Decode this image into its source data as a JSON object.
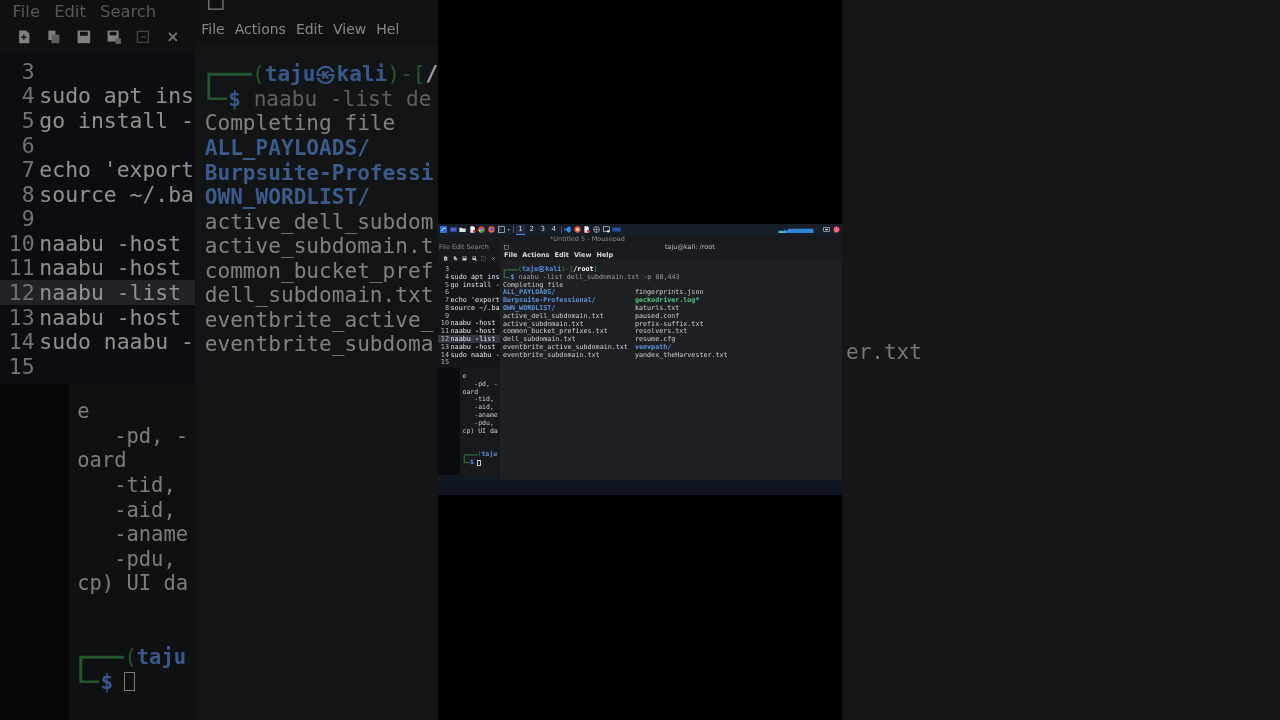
{
  "left_backdrop": {
    "editor": {
      "menu": [
        "File",
        "Edit",
        "Search"
      ],
      "lines": [
        {
          "number": "3",
          "selected": false
        },
        {
          "number": "4",
          "code": "sudo apt ins",
          "selected": false
        },
        {
          "number": "5",
          "code": "go install -",
          "selected": false
        },
        {
          "number": "6",
          "selected": false
        },
        {
          "number": "7",
          "code": "echo 'export",
          "selected": false
        },
        {
          "number": "8",
          "code": "source ~/.ba",
          "selected": false
        },
        {
          "number": "9",
          "selected": false
        },
        {
          "number": "10",
          "code": "naabu -host",
          "selected": false
        },
        {
          "number": "11",
          "code": "naabu -host",
          "selected": false
        },
        {
          "number": "12",
          "code": "naabu -list",
          "selected": true
        },
        {
          "number": "13",
          "code": "naabu -host",
          "selected": false
        },
        {
          "number": "14",
          "code": "sudo naabu -",
          "selected": false
        },
        {
          "number": "15",
          "selected": false
        }
      ]
    },
    "terminal": {
      "menu": [
        "File",
        "Actions",
        "Edit",
        "View",
        "Hel"
      ],
      "prompt": "(**taju㉿kali**)-[**/**",
      "symbol": "$",
      "command": "naabu -list de",
      "message": "Completing file",
      "listing": [
        {
          "name": "ALL_PAYLOADS/",
          "kind": "dir"
        },
        {
          "name": "Burpsuite-Professi",
          "kind": "dir"
        },
        {
          "name": "OWN_WORDLIST/",
          "kind": "dir"
        },
        {
          "name": "active_dell_subdom",
          "kind": "file"
        },
        {
          "name": "active_subdomain.t",
          "kind": "file"
        },
        {
          "name": "common_bucket_pref",
          "kind": "file"
        },
        {
          "name": "dell_subdomain.txt",
          "kind": "file"
        },
        {
          "name": "eventbrite_active_",
          "kind": "file"
        },
        {
          "name": "eventbrite_subdoma",
          "kind": "file"
        }
      ]
    },
    "back_terminal": {
      "lines": [
        "e",
        "   -pd, -",
        "oard",
        "   -tid,",
        "   -aid,",
        "   -aname",
        "   -pdu,",
        "cp) UI da"
      ],
      "prompt": "(**taju**",
      "symbol": "$"
    }
  },
  "center_screen": {
    "taskbar": {
      "workspaces": [
        {
          "label": "1",
          "selected": true
        },
        {
          "label": "2",
          "selected": false
        },
        {
          "label": "3",
          "selected": false
        },
        {
          "label": "4",
          "selected": false
        }
      ]
    },
    "editor": {
      "title": "*Untitled 5 - Mousepad",
      "menu": [
        "File",
        "Edit",
        "Search"
      ],
      "lines": [
        {
          "number": "3",
          "selected": false
        },
        {
          "number": "4",
          "code": "sudo apt ins",
          "selected": false
        },
        {
          "number": "5",
          "code": "go install -",
          "selected": false
        },
        {
          "number": "6",
          "selected": false
        },
        {
          "number": "7",
          "code": "echo 'export",
          "selected": false
        },
        {
          "number": "8",
          "code": "source ~/.ba",
          "selected": false
        },
        {
          "number": "9",
          "selected": false
        },
        {
          "number": "10",
          "code": "naabu -host",
          "selected": false
        },
        {
          "number": "11",
          "code": "naabu -host",
          "selected": false
        },
        {
          "number": "12",
          "code": "naabu -list",
          "selected": true
        },
        {
          "number": "13",
          "code": "naabu -host",
          "selected": false
        },
        {
          "number": "14",
          "code": "sudo naabu -",
          "selected": false
        },
        {
          "number": "15",
          "selected": false
        }
      ]
    },
    "terminal": {
      "title": "taju@kali: /root",
      "menu": [
        "File",
        "Actions",
        "Edit",
        "View",
        "Help"
      ],
      "prompt": "(**taju㉿kali**)-[**/root**]",
      "symbol": "$",
      "command": "naabu -list dell_subdomain.txt -p 80,443",
      "message": "Completing file",
      "listing": [
        {
          "name": "ALL_PAYLOADS/",
          "kind": "dir"
        },
        {
          "name": "Burpsuite-Professional/",
          "kind": "dir"
        },
        {
          "name": "OWN_WORDLIST/",
          "kind": "dir"
        },
        {
          "name": "active_dell_subdomain.txt",
          "kind": "file"
        },
        {
          "name": "active_subdomain.txt",
          "kind": "file"
        },
        {
          "name": "common_bucket_prefixes.txt",
          "kind": "file"
        },
        {
          "name": "dell_subdomain.txt",
          "kind": "file"
        },
        {
          "name": "eventbrite_active_subdomain.txt",
          "kind": "file"
        },
        {
          "name": "eventbrite_subdomain.txt",
          "kind": "file"
        },
        {
          "name": "fingerprints.json",
          "kind": "file"
        },
        {
          "name": "geckodriver.log*",
          "kind": "exec"
        },
        {
          "name": "katurls.txt",
          "kind": "file"
        },
        {
          "name": "paused.conf",
          "kind": "file"
        },
        {
          "name": "prefix-suffix.txt",
          "kind": "file"
        },
        {
          "name": "resolvers.txt",
          "kind": "file"
        },
        {
          "name": "resume.cfg",
          "kind": "file"
        },
        {
          "name": "venvpath/",
          "kind": "dir"
        },
        {
          "name": "yandex_theHarvester.txt",
          "kind": "file"
        }
      ]
    },
    "back_terminal": {
      "lines": [
        "e",
        "   -pd, -",
        "oard",
        "   -tid,",
        "   -aid,",
        "   -aname",
        "   -pdu,",
        "cp) UI da"
      ],
      "prompt": "(**taju**",
      "symbol": "$"
    }
  },
  "right_backdrop": {
    "text": "er.txt"
  }
}
